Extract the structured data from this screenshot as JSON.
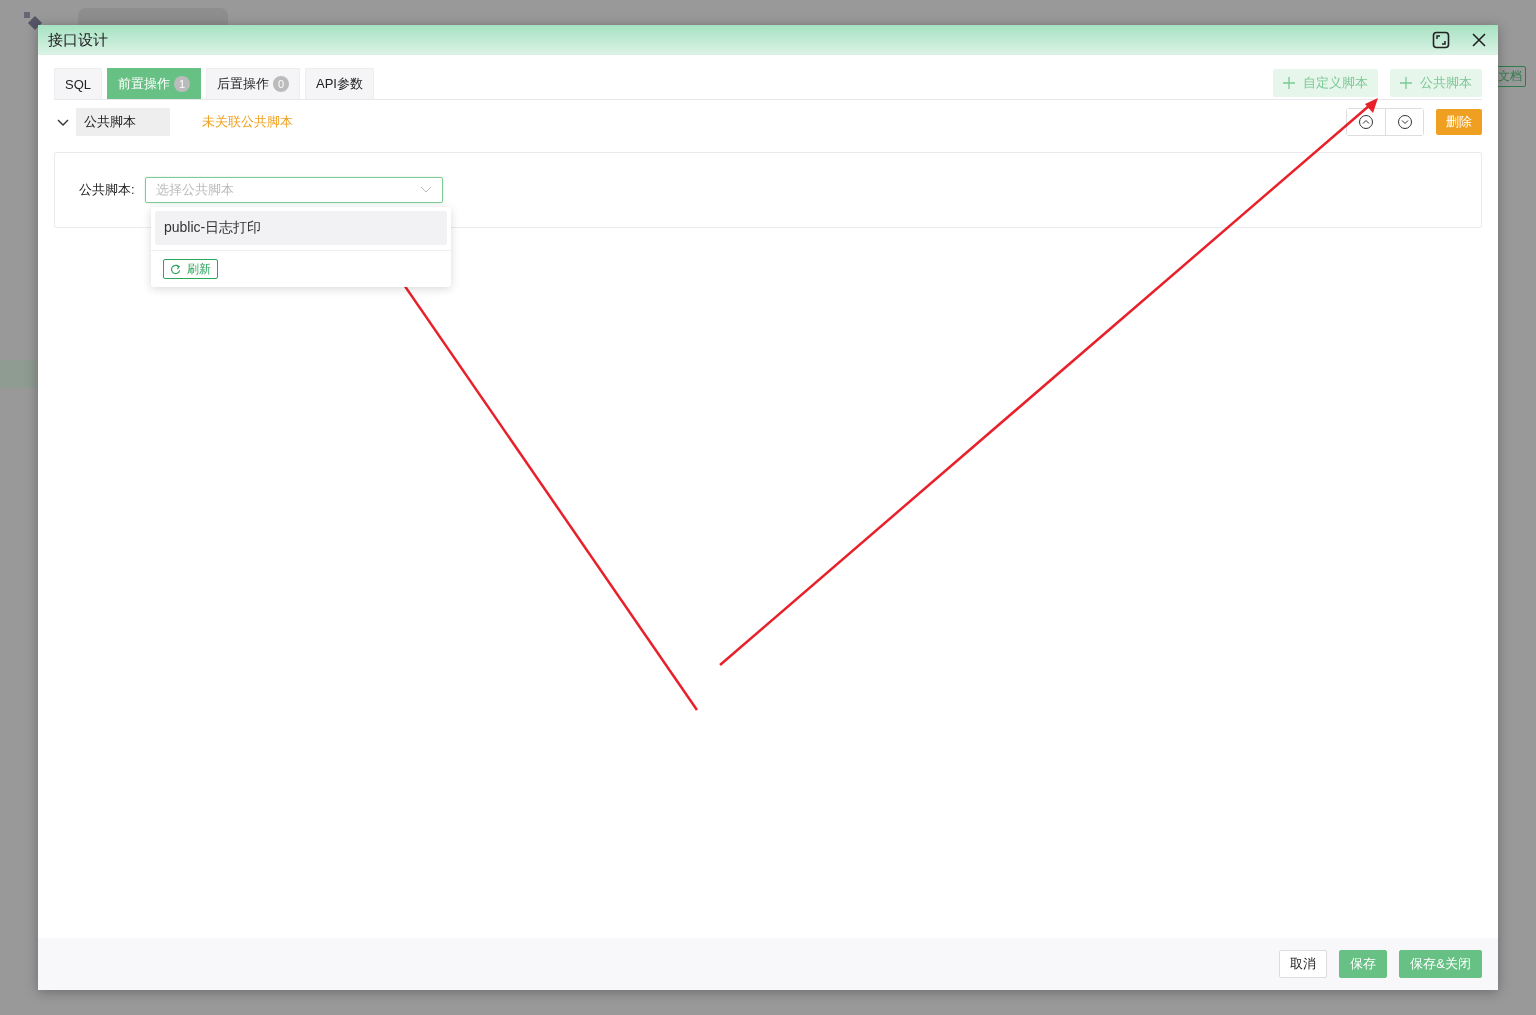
{
  "background": {
    "doc_button": "文档"
  },
  "dialog": {
    "title": "接口设计",
    "tabs": [
      {
        "label": "SQL",
        "selected": false
      },
      {
        "label": "前置操作",
        "badge": "1",
        "selected": true
      },
      {
        "label": "后置操作",
        "badge": "0",
        "selected": false
      },
      {
        "label": "API参数",
        "selected": false
      }
    ],
    "actions": [
      "自定义脚本",
      "公共脚本"
    ],
    "script": {
      "title": "公共脚本",
      "expanded": true,
      "status": "未关联公共脚本",
      "delete": "删除",
      "field_label": "公共脚本:",
      "placeholder": "选择公共脚本",
      "options": [
        {
          "label": "public-日志打印",
          "hovered": true
        }
      ],
      "refresh": "刷新"
    },
    "footer": [
      {
        "label": "取消",
        "kind": "plain"
      },
      {
        "label": "保存",
        "kind": "primary"
      },
      {
        "label": "保存&关闭",
        "kind": "primary"
      }
    ]
  }
}
